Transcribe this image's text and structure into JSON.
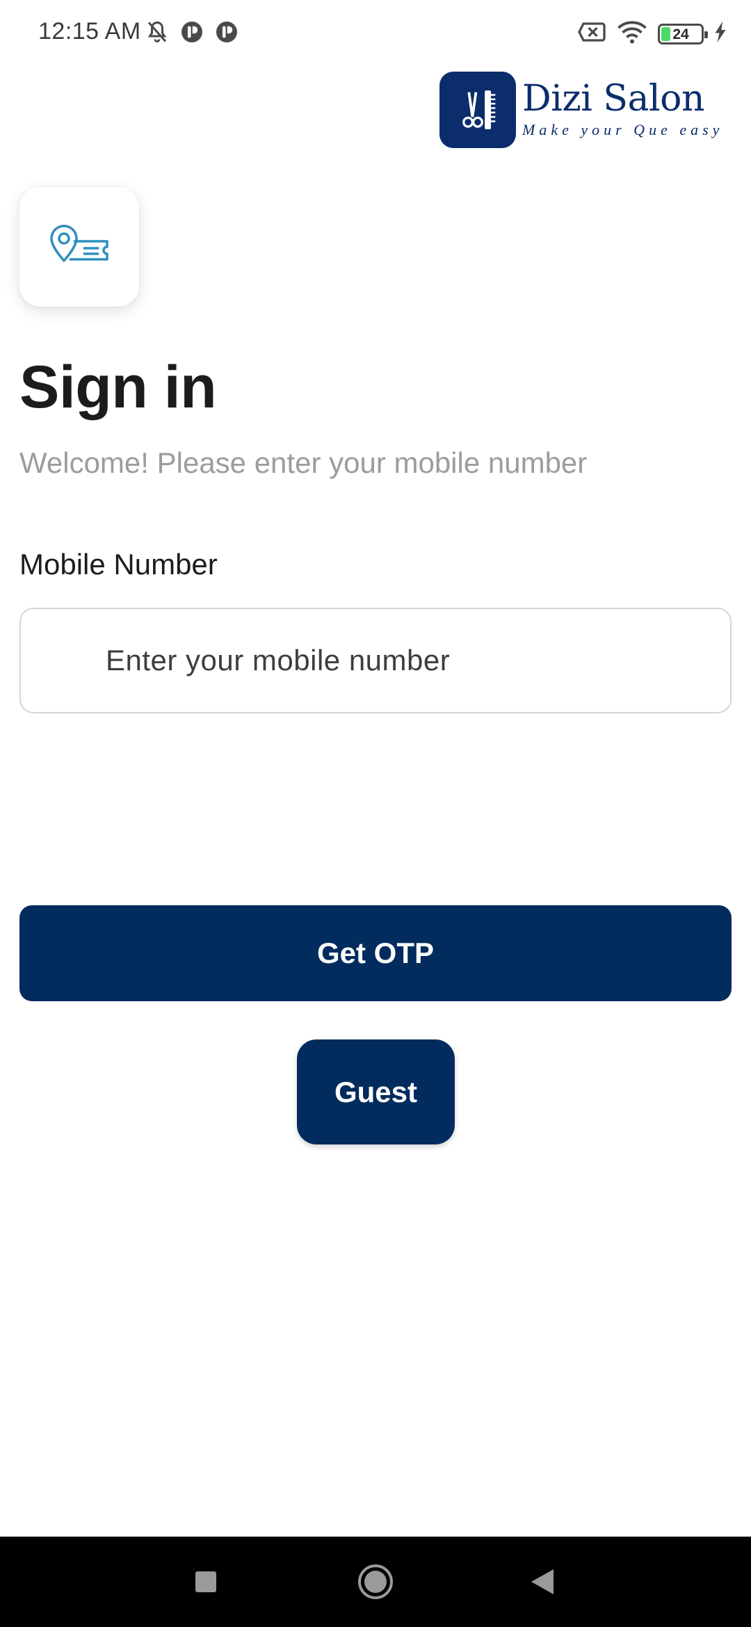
{
  "status_bar": {
    "time": "12:15 AM",
    "battery_level": "24",
    "battery_fraction": 0.24,
    "icons": [
      "bell-muted-icon",
      "app-notification-icon",
      "app-notification-icon",
      "sim-x-icon",
      "wifi-icon",
      "battery-icon",
      "charging-bolt-icon"
    ]
  },
  "brand": {
    "name": "Dizi Salon",
    "tagline": "Make your Que easy",
    "logo_icon": "scissors-comb-icon",
    "color": "#0b2d6b"
  },
  "app_icon": {
    "icon": "location-ticket-icon",
    "color": "#2e8fbf"
  },
  "signin": {
    "title": "Sign in",
    "subtitle": "Welcome! Please enter your mobile number",
    "field_label": "Mobile Number",
    "mobile_value": "",
    "mobile_placeholder": "Enter your mobile number",
    "get_otp_label": "Get OTP",
    "guest_label": "Guest"
  },
  "theme": {
    "primary": "#022c5d",
    "accent_battery": "#4cd964"
  },
  "nav_bar": {
    "buttons": [
      "recents-square-icon",
      "home-circle-icon",
      "back-triangle-icon"
    ]
  }
}
